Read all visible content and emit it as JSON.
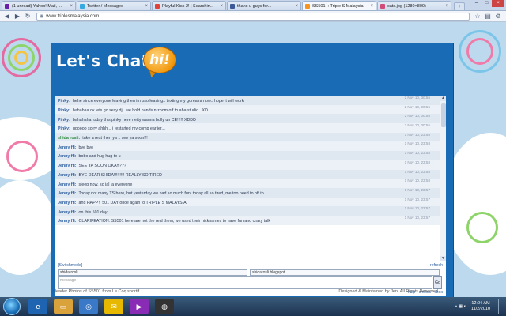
{
  "browser": {
    "tabs": [
      {
        "label": "(1 unread) Yahoo! Mail, ...",
        "color": "#6a1fa8"
      },
      {
        "label": "Twitter / Messages",
        "color": "#36a9e0"
      },
      {
        "label": "Playful Kiss 2! | Searchin...",
        "color": "#e0423a"
      },
      {
        "label": "thanx u guys for...",
        "color": "#3b5998"
      },
      {
        "label": "SS501 :: Triple S Malaysia",
        "color": "#f7941d"
      },
      {
        "label": "cats.jpg (1280×800)",
        "color": "#d24c7a"
      }
    ],
    "url": "www.triplesmalaysia.com",
    "window_controls": [
      "–",
      "□",
      "×"
    ]
  },
  "chat": {
    "title": "Let's Chat!",
    "badge": "hi!",
    "messages": [
      {
        "name": "Pinky:",
        "text": "hehe since everyone leaving then im oso leaving.. texting my gorealra now.. hope it will work",
        "time": "2 Nov 10, 00:55",
        "green": false
      },
      {
        "name": "Pinky:",
        "text": "hahahaa ok lets go sexy dj.. we hold hands n zoom off to aba studio.. XD",
        "time": "2 Nov 10, 00:55",
        "green": false
      },
      {
        "name": "Pinky:",
        "text": "bahahaha today this pinky here netty wanna bully un CE!!!!! XDDD",
        "time": "2 Nov 10, 00:55",
        "green": false
      },
      {
        "name": "Pinky:",
        "text": "ugoooo sorry ahhh... i restarted my comp earlier...",
        "time": "2 Nov 10, 00:55",
        "green": false
      },
      {
        "name": "shida rosli:",
        "text": "take a rest then ya .. see ya soon!!!",
        "time": "1 Nov 10, 23:58",
        "green": true
      },
      {
        "name": "Jenny ffi:",
        "text": "bye bye",
        "time": "1 Nov 10, 23:58",
        "green": false
      },
      {
        "name": "Jenny ffi:",
        "text": "bobo and hug hug to u",
        "time": "1 Nov 10, 23:58",
        "green": false
      },
      {
        "name": "Jenny ffi:",
        "text": "SEE YA SOON OKAY???",
        "time": "1 Nov 10, 23:58",
        "green": false
      },
      {
        "name": "Jenny ffi:",
        "text": "BYE DEAR SHIDA!!!!!!!!! REALLY SO TIRED",
        "time": "1 Nov 10, 23:58",
        "green": false
      },
      {
        "name": "Jenny ffi:",
        "text": "sleep now, so jal ja everyone",
        "time": "1 Nov 10, 23:58",
        "green": false
      },
      {
        "name": "Jenny ffi:",
        "text": "Today not many TS here, but yesterday we had so much fun, today all so tired, me too need to off to",
        "time": "1 Nov 10, 23:57",
        "green": false
      },
      {
        "name": "Jenny ffi:",
        "text": "and HAPPY 501 DAY once again to TRIPLE S MALAYSIA",
        "time": "1 Nov 10, 23:57",
        "green": false
      },
      {
        "name": "Jenny ffi:",
        "text": "on this 501 day",
        "time": "1 Nov 10, 23:57",
        "green": false
      },
      {
        "name": "Jenny ffi:",
        "text": "CLARIFEATION: SS501 here are not the real them, we used their nicknames to have fun and crazy talk",
        "time": "1 Nov 10, 23:57",
        "green": false
      }
    ],
    "switch_mode": "[Switchmode]",
    "refresh": "refresh",
    "name_value": "shida rosli",
    "url_value": "shidarosli.blogspot",
    "message_placeholder": "message",
    "go_label": "Go",
    "links": "help · smilies · cbox"
  },
  "footer": {
    "left": "Header Photos of SS501 from Le Coq sportif.",
    "right": "Designed & Maintained by Jen. All Rights Reserved"
  },
  "taskbar": {
    "time": "12:04 AM",
    "date": "11/2/2010"
  }
}
